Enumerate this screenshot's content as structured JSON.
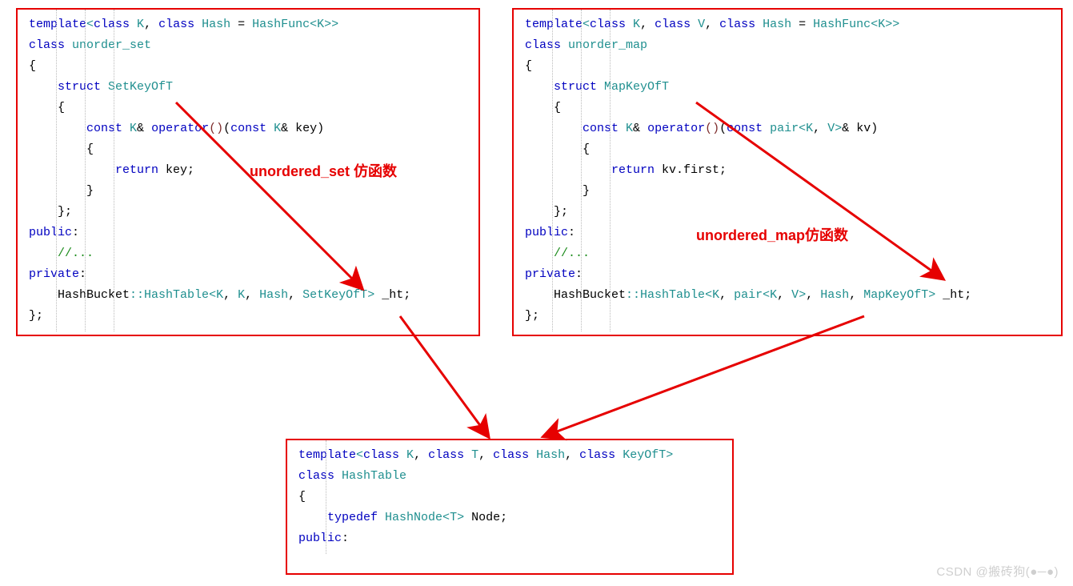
{
  "labels": {
    "set_functor": "unordered_set 仿函数",
    "map_functor": "unordered_map仿函数"
  },
  "watermark": "CSDN @搬砖狗(●─●)",
  "code": {
    "set": {
      "l1_a": "template",
      "l1_b": "<",
      "l1_c": "class",
      "l1_d": " K",
      "l1_e": ", ",
      "l1_f": "class",
      "l1_g": " Hash ",
      "l1_h": "=",
      "l1_i": " HashFunc",
      "l1_j": "<",
      "l1_k": "K",
      "l1_l": ">>",
      "l2_a": "class",
      "l2_b": " unorder_set",
      "l3": "{",
      "l4_a": "    ",
      "l4_b": "struct",
      "l4_c": " SetKeyOfT",
      "l5": "    {",
      "l6_a": "        ",
      "l6_b": "const",
      "l6_c": " K",
      "l6_d": "& ",
      "l6_e": "operator",
      "l6_f": "()",
      "l6_g": "(",
      "l6_h": "const",
      "l6_i": " K",
      "l6_j": "& key)",
      "l7": "        {",
      "l8_a": "            ",
      "l8_b": "return",
      "l8_c": " key;",
      "l9": "        }",
      "l10": "    };",
      "l11_a": "public",
      "l11_b": ":",
      "l12_a": "    ",
      "l12_b": "//...",
      "l13_a": "private",
      "l13_b": ":",
      "l14_a": "    HashBucket",
      "l14_b": "::",
      "l14_c": "HashTable",
      "l14_d": "<",
      "l14_e": "K",
      "l14_f": ", ",
      "l14_g": "K",
      "l14_h": ", ",
      "l14_i": "Hash",
      "l14_j": ", ",
      "l14_k": "SetKeyOfT",
      "l14_l": ">",
      "l14_m": " _ht;",
      "l15": "};"
    },
    "map": {
      "l1_a": "template",
      "l1_b": "<",
      "l1_c": "class",
      "l1_d": " K",
      "l1_e": ", ",
      "l1_f": "class",
      "l1_g": " V",
      "l1_h": ", ",
      "l1_i": "class",
      "l1_j": " Hash ",
      "l1_k": "=",
      "l1_l": " HashFunc",
      "l1_m": "<",
      "l1_n": "K",
      "l1_o": ">>",
      "l2_a": "class",
      "l2_b": " unorder_map",
      "l3": "{",
      "l4_a": "    ",
      "l4_b": "struct",
      "l4_c": " MapKeyOfT",
      "l5": "    {",
      "l6_a": "        ",
      "l6_b": "const",
      "l6_c": " K",
      "l6_d": "& ",
      "l6_e": "operator",
      "l6_f": "()",
      "l6_g": "(",
      "l6_h": "const",
      "l6_i": " pair",
      "l6_j": "<",
      "l6_k": "K",
      "l6_l": ", ",
      "l6_m": "V",
      "l6_n": ">",
      "l6_o": "& kv)",
      "l7": "        {",
      "l8_a": "            ",
      "l8_b": "return",
      "l8_c": " kv.first;",
      "l9": "        }",
      "l10": "    };",
      "l11_a": "public",
      "l11_b": ":",
      "l12_a": "    ",
      "l12_b": "//...",
      "l13_a": "private",
      "l13_b": ":",
      "l14_a": "    HashBucket",
      "l14_b": "::",
      "l14_c": "HashTable",
      "l14_d": "<",
      "l14_e": "K",
      "l14_f": ", ",
      "l14_g": "pair",
      "l14_h": "<",
      "l14_i": "K",
      "l14_j": ", ",
      "l14_k": "V",
      "l14_l": ">",
      "l14_m": ", ",
      "l14_n": "Hash",
      "l14_o": ", ",
      "l14_p": "MapKeyOfT",
      "l14_q": ">",
      "l14_r": " _ht;",
      "l15": "};"
    },
    "ht": {
      "l1_a": "template",
      "l1_b": "<",
      "l1_c": "class",
      "l1_d": " K",
      "l1_e": ", ",
      "l1_f": "class",
      "l1_g": " T",
      "l1_h": ", ",
      "l1_i": "class",
      "l1_j": " Hash",
      "l1_k": ", ",
      "l1_l": "class",
      "l1_m": " KeyOfT",
      "l1_n": ">",
      "l2_a": "class",
      "l2_b": " HashTable",
      "l3": "{",
      "l4_a": "    ",
      "l4_b": "typedef",
      "l4_c": " HashNode",
      "l4_d": "<",
      "l4_e": "T",
      "l4_f": ">",
      "l4_g": " Node;",
      "l5_a": "public",
      "l5_b": ":"
    }
  }
}
